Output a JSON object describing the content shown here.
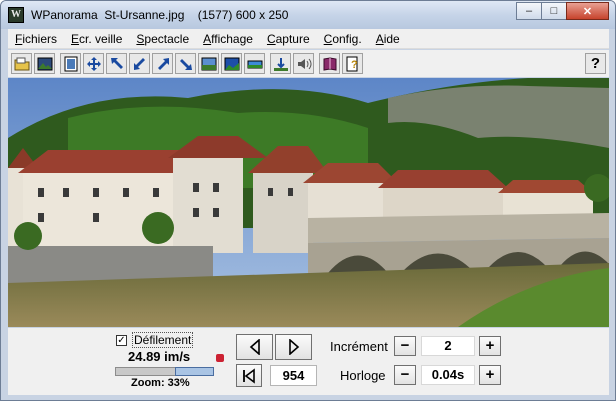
{
  "window": {
    "title": "WPanorama  St-Ursanne.jpg    (1577) 600 x 250",
    "app_icon_glyph": "W",
    "minimize_glyph": "–",
    "maximize_glyph": "□",
    "close_glyph": "✕"
  },
  "menubar": {
    "items": [
      "Fichiers",
      "Ecr. veille",
      "Spectacle",
      "Affichage",
      "Capture",
      "Config.",
      "Aide"
    ]
  },
  "toolbar": {
    "icons": [
      "open-file-icon",
      "picture-icon",
      "picture-frame-icon",
      "move-all-icon",
      "arrow-up-left-icon",
      "arrow-down-left-icon",
      "arrow-up-right-icon",
      "arrow-down-right-icon",
      "screen-icon",
      "landscape-icon",
      "panorama-strip-icon",
      "ground-icon",
      "speaker-icon",
      "book-icon",
      "help-page-icon"
    ],
    "help_label": "?"
  },
  "controls": {
    "scroll_checkbox_label": "Défilement",
    "scroll_checked": true,
    "check_glyph": "✓",
    "speed": "24.89 im/s",
    "zoom_label": "Zoom: 33%",
    "zoom_level": 0.33,
    "frame_counter": "954",
    "increment_label": "Incrément",
    "increment_value": "2",
    "clock_label": "Horloge",
    "clock_value": "0.04s",
    "minus_glyph": "−",
    "plus_glyph": "+"
  },
  "colors": {
    "title_bar": "#c6d4e8",
    "close_button": "#c7432c",
    "panel_bg": "#f0f0f0"
  }
}
